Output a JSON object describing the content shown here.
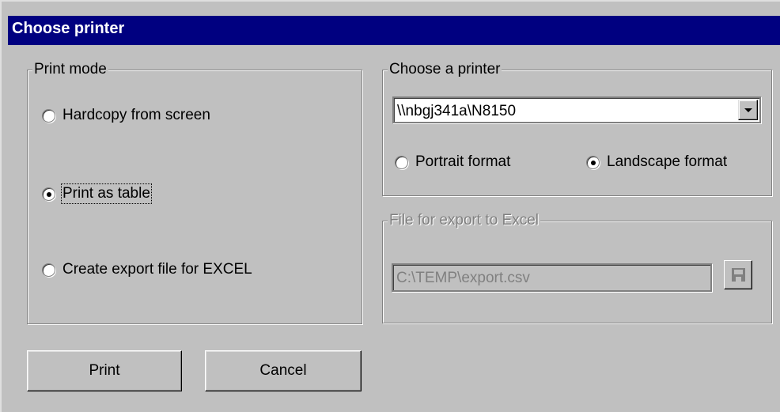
{
  "window": {
    "title": "Choose printer"
  },
  "print_mode": {
    "legend": "Print mode",
    "options": [
      {
        "label": "Hardcopy from screen",
        "selected": false
      },
      {
        "label": "Print as table",
        "selected": true
      },
      {
        "label": "Create export file for EXCEL",
        "selected": false
      }
    ]
  },
  "printer": {
    "legend": "Choose a printer",
    "selected_printer": "\\\\nbgj341a\\N8150",
    "orientation": [
      {
        "label": "Portrait format",
        "selected": false
      },
      {
        "label": "Landscape format",
        "selected": true
      }
    ]
  },
  "export": {
    "legend": "File for export to Excel",
    "file_path": "C:\\TEMP\\export.csv",
    "enabled": false,
    "save_icon": "floppy-disk-icon"
  },
  "buttons": {
    "print_label": "Print",
    "cancel_label": "Cancel"
  },
  "colors": {
    "titlebar": "#000080",
    "face": "#c0c0c0",
    "disabled_text": "#808080"
  }
}
